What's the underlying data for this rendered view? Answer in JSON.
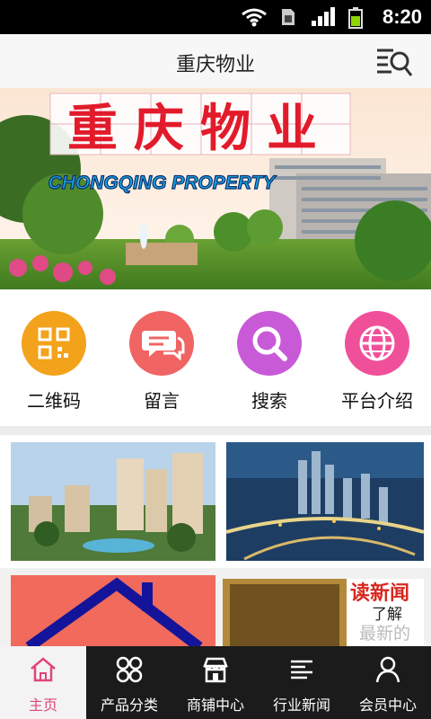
{
  "status_bar": {
    "time": "8:20"
  },
  "header": {
    "title": "重庆物业"
  },
  "banner": {
    "title_cn": "重庆物业",
    "title_en": "CHONGQING PROPERTY"
  },
  "quick_actions": [
    {
      "label": "二维码",
      "icon": "qr-code-icon",
      "color": "#f3a21b"
    },
    {
      "label": "留言",
      "icon": "message-icon",
      "color": "#f06464"
    },
    {
      "label": "搜索",
      "icon": "search-icon",
      "color": "#c85ad8"
    },
    {
      "label": "平台介绍",
      "icon": "globe-icon",
      "color": "#f0509a"
    }
  ],
  "news_ad": {
    "line1": "读新闻",
    "line2": "了解",
    "line3": "最新的"
  },
  "tabs": [
    {
      "label": "主页",
      "icon": "home-icon",
      "active": true
    },
    {
      "label": "产品分类",
      "icon": "category-icon",
      "active": false
    },
    {
      "label": "商铺中心",
      "icon": "shop-icon",
      "active": false
    },
    {
      "label": "行业新闻",
      "icon": "news-icon",
      "active": false
    },
    {
      "label": "会员中心",
      "icon": "user-icon",
      "active": false
    }
  ],
  "colors": {
    "accent": "#e0457a",
    "tabbar_bg": "#1b1b1b"
  }
}
